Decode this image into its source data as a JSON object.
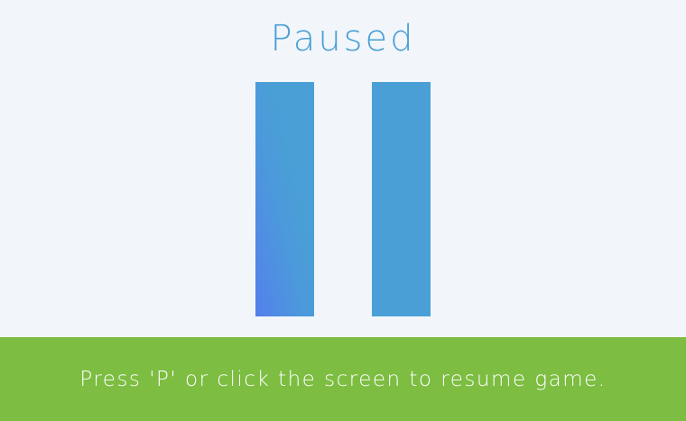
{
  "game": {
    "state": "paused",
    "title": "Paused",
    "icon": "pause-icon",
    "resume_hint": "Press 'P' or click the screen to resume game."
  },
  "colors": {
    "background": "#f2f6fa",
    "accent": "#4aa0d6",
    "footer": "#7dbd42",
    "footer_text": "#ffffff"
  }
}
